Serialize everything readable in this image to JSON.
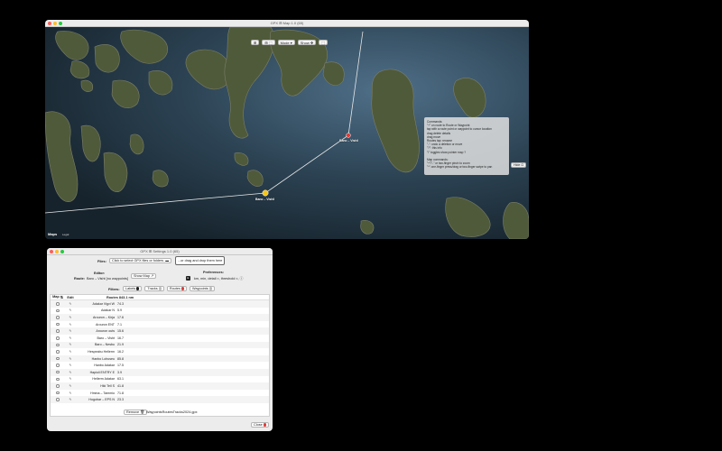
{
  "map_window": {
    "title": "GPX ⊞ Map 1.0 (65)",
    "toolbar": {
      "btn1": "⊞",
      "btn2": "⊞ ⬚",
      "btn3": "Mode ▾",
      "btn4": "Show ✥",
      "btn5": "⬚"
    },
    "commands": {
      "lines": [
        "Commands:",
        "\"+\" on route to Route or Waypoint",
        "tap with a route point or waypoint to cursor location",
        "drag delete details",
        "drag move",
        "Routes tap: rename",
        "\"-\": undo a deletion or move",
        "\"?\": this info",
        "\"/\" toggles show pointer map ?",
        "",
        "Map commands:",
        "\"+\"/\"-\" or two-finger pinch to zoom",
        "\"^\" one-finger press/drag or two-finger swipe to pan"
      ]
    },
    "side_button": "Hide ⊡",
    "maps_logo": "Maps",
    "legal": "Legal",
    "waypoints": [
      {
        "label": "Bano – Vishil"
      },
      {
        "label": "Bano – Vishil"
      }
    ],
    "colors": {
      "route_line": "#e8e8e8",
      "waypoint_yellow": "#f5c518",
      "waypoint_red": "#e53935"
    }
  },
  "settings_window": {
    "title": "GPX ⊞ Settings 1.0 (65)",
    "files_label": "Files:",
    "select_files_btn": "Click to select GPX files or folders",
    "select_files_icon": "folder-icon",
    "drop_btn": "...or drag and drop them here",
    "editor_label": "Editor:",
    "route_label": "Route:",
    "route_value": "Baro – Visht   [no waypoints]",
    "show_map_btn": "Show Map ↗",
    "preferences_label": "Preferences:",
    "preferences_value": "km, min, detail ≈, threshold ≈, ⓘ",
    "filters_label": "Filters:",
    "filters": [
      {
        "label": "Labels",
        "color": "#222222"
      },
      {
        "label": "Tracks",
        "color": "#bbbbbb"
      },
      {
        "label": "Routes",
        "color": "#e53935"
      },
      {
        "label": "Waypoints",
        "color": "#bbbbbb"
      }
    ],
    "table": {
      "headers": {
        "map": "Map",
        "map_icon": "⇅",
        "edit": "Edit",
        "routes": "Routes 843.1 nm"
      },
      "rows": [
        {
          "name": "Adakar Vigvi W",
          "km": "74.3"
        },
        {
          "name": "Adakar N",
          "km": "5.9"
        },
        {
          "name": "Arouron – Kirja",
          "km": "17.6"
        },
        {
          "name": "Arouron ENT",
          "km": "7.1"
        },
        {
          "name": "Arouron outs",
          "km": "15.6"
        },
        {
          "name": "Baro – Visht",
          "km": "16.7"
        },
        {
          "name": "Baro – Nesbu",
          "km": "21.9"
        },
        {
          "name": "Hespeabu Hellerm",
          "km": "16.2"
        },
        {
          "name": "Hanbo Lohuseu",
          "km": "85.8"
        },
        {
          "name": "Hanbo Adakar",
          "km": "17.5"
        },
        {
          "name": "Hapioli ENTRY E",
          "km": "3.9"
        },
        {
          "name": "Hellerm Adakar",
          "km": "63.1"
        },
        {
          "name": "Hiki Tell S",
          "km": "41.8"
        },
        {
          "name": "Hmina – Tammio",
          "km": "71.8"
        },
        {
          "name": "Hogobar – EPS N",
          "km": "23.3"
        }
      ]
    },
    "remove_btn": "Remove 🗑",
    "file_path": "WaypointsRoutesTracks2024.gpx",
    "close_btn": "Close"
  }
}
